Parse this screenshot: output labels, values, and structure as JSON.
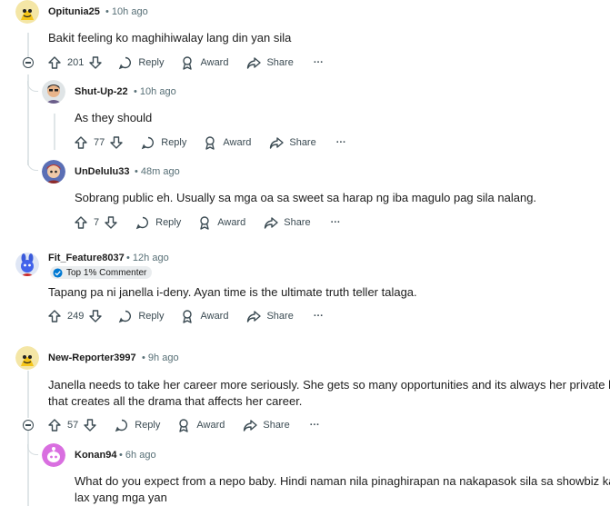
{
  "icons": [
    "upvote-icon",
    "downvote-icon",
    "reply-icon",
    "award-icon",
    "share-icon",
    "more-icon",
    "collapse-icon",
    "verified-badge-icon"
  ],
  "actions": {
    "reply": "Reply",
    "award": "Award",
    "share": "Share",
    "more": "···"
  },
  "comments": [
    {
      "user": "Opitunia25",
      "time": "10h ago",
      "text": "Bakit feeling ko maghihiwalay lang din yan sila",
      "votes": "201"
    },
    {
      "user": "Shut-Up-22",
      "time": "10h ago",
      "text": "As they should",
      "votes": "77"
    },
    {
      "user": "UnDelulu33",
      "time": "48m ago",
      "text": "Sobrang public eh. Usually sa mga oa sa sweet sa harap ng iba magulo pag sila nalang.",
      "votes": "7"
    },
    {
      "user": "Fit_Feature8037",
      "time": "12h ago",
      "badge": "Top 1% Commenter",
      "text": "Tapang pa ni janella i-deny. Ayan time is the ultimate truth teller talaga.",
      "votes": "249"
    },
    {
      "user": "New-Reporter3997",
      "time": "9h ago",
      "text_line1": "Janella needs to take her career more seriously. She gets so many opportunities and its always her private life",
      "text_line2": "that creates all the drama that affects her career.",
      "votes": "57"
    },
    {
      "user": "Konan94",
      "time": "6h ago",
      "text_line1": "What do you expect from a nepo baby. Hindi naman nila pinaghirapan na nakapasok sila sa showbiz kaya",
      "text_line2": "lax yang mga yan"
    }
  ]
}
